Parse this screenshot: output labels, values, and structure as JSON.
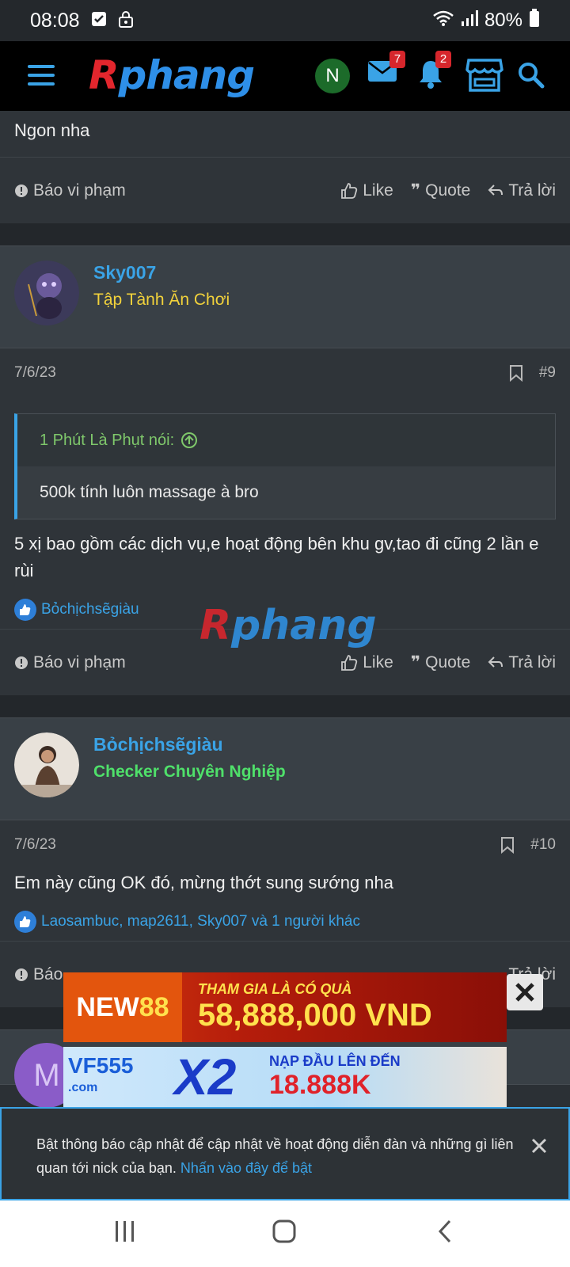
{
  "status": {
    "time": "08:08",
    "battery": "80%"
  },
  "nav": {
    "logo_r": "R",
    "logo_rest": "phang",
    "avatar_letter": "N",
    "mail_badge": "7",
    "bell_badge": "2"
  },
  "post_top": {
    "text": "Ngon nha"
  },
  "actions": {
    "report": "Báo vi phạm",
    "like": "Like",
    "quote": "Quote",
    "reply": "Trả lời"
  },
  "post9": {
    "username": "Sky007",
    "user_title": "Tập Tành Ăn Chơi",
    "date": "7/6/23",
    "number": "#9",
    "quote_author": "1 Phút Là Phụt nói:",
    "quote_text": "500k tính luôn massage à bro",
    "text": "5 xị bao gồm các dịch vụ,e hoạt động bên khu gv,tao đi cũng 2 lần e rùi",
    "likes": "Bỏchịchsẽgiàu"
  },
  "post10": {
    "username": "Bỏchịchsẽgiàu",
    "user_title": "Checker Chuyên Nghiệp",
    "date": "7/6/23",
    "number": "#10",
    "text": "Em này cũng OK đó, mừng thớt sung sướng nha",
    "likes": "Laosambuc, map2611, Sky007 và 1 người khác",
    "report_partial": "Báo",
    "reply_partial": "Trả lời"
  },
  "ads": {
    "ad1_brand_a": "NEW",
    "ad1_brand_b": "88",
    "ad1_line1": "THAM GIA LÀ CÓ QUÀ",
    "ad1_line2": "58,888,000 VND",
    "ad2_brand": "VF555",
    "ad2_brand_sub": ".com",
    "ad2_x2": "X2",
    "ad2_line1": "NẠP ĐẦU LÊN ĐẾN",
    "ad2_line2": "18.888K"
  },
  "notice": {
    "text": "Bật thông báo cập nhật để cập nhật về hoạt động diễn đàn và những gì liên quan tới nick của bạn. ",
    "link": "Nhấn vào đây để bật"
  },
  "next_avatar_letter": "M",
  "colors": {
    "accent": "#3aa3e6",
    "title_yellow": "#f2d23b",
    "title_green": "#4fe06a",
    "quote_green": "#7fc86b"
  }
}
